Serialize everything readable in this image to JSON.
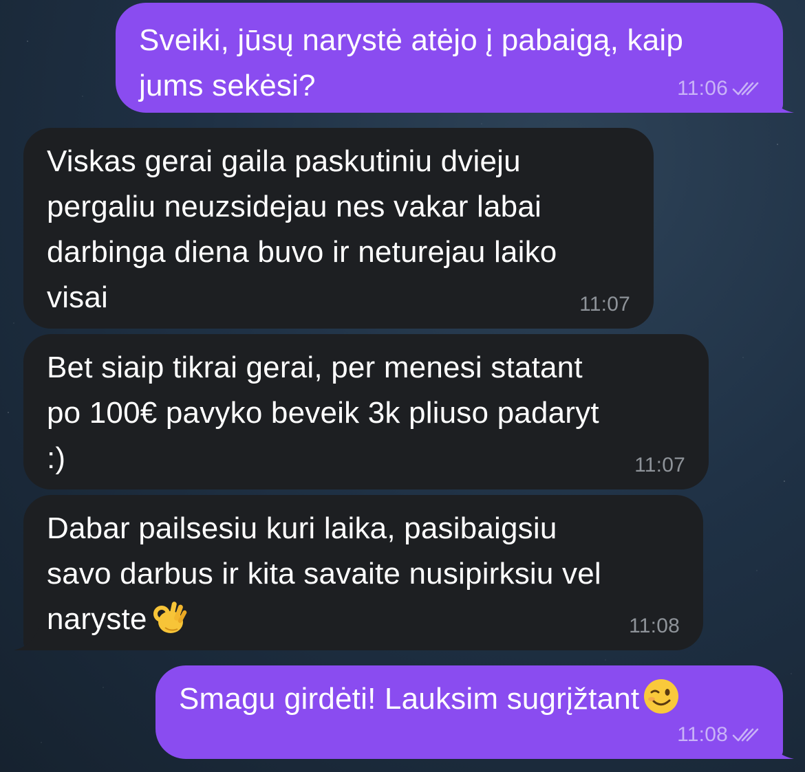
{
  "messages": [
    {
      "direction": "outgoing",
      "text": "Sveiki, jūsų narystė atėjo į pabaigą, kaip\njums sekėsi?",
      "time": "11:06",
      "status": "read"
    },
    {
      "direction": "incoming",
      "text": "Viskas gerai gaila paskutiniu dvieju\npergaliu neuzsidejau nes vakar labai\ndarbinga diena buvo ir neturejau laiko\nvisai",
      "time": "11:07"
    },
    {
      "direction": "incoming",
      "text": "Bet siaip tikrai gerai, per menesi statant\npo 100€ pavyko beveik 3k pliuso padaryt\n:)",
      "time": "11:07"
    },
    {
      "direction": "incoming",
      "text": "Dabar pailsesiu kuri laika, pasibaigsiu\nsavo darbus ir kita savaite nusipirksiu vel\nnaryste",
      "emoji": "ok-hand",
      "time": "11:08"
    },
    {
      "direction": "outgoing",
      "text": "Smagu girdėti! Lauksim sugrįžtant",
      "emoji": "winking-face",
      "time": "11:08",
      "status": "read"
    }
  ],
  "colors": {
    "outgoing_bubble": "#8a4cf0",
    "incoming_bubble": "#1d1f22",
    "background": "#1f3145"
  }
}
